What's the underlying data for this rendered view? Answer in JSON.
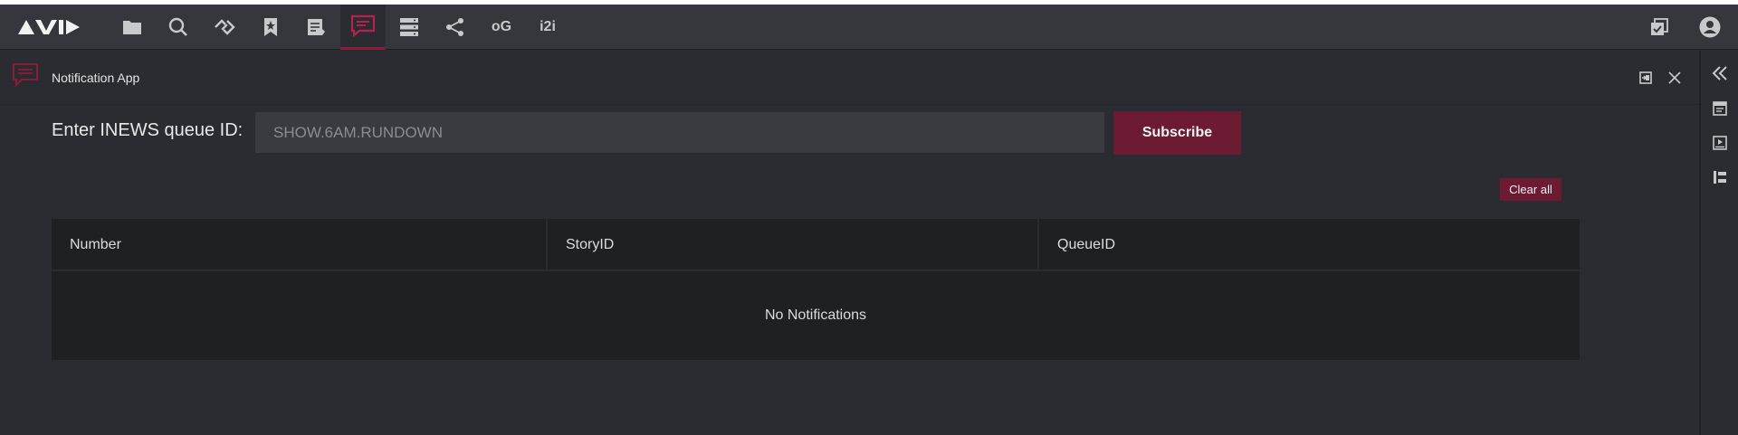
{
  "topbar": {
    "tools": [
      {
        "name": "folder-icon"
      },
      {
        "name": "search-icon"
      },
      {
        "name": "link-icon"
      },
      {
        "name": "bookmark-star-icon"
      },
      {
        "name": "document-edit-icon"
      },
      {
        "name": "chat-icon",
        "active": true
      },
      {
        "name": "server-icon"
      },
      {
        "name": "share-icon"
      },
      {
        "name": "og-text-icon",
        "label": "oG"
      },
      {
        "name": "i2i-text-icon",
        "label": "i2i"
      }
    ],
    "right": [
      "tasks-icon",
      "user-avatar-icon"
    ]
  },
  "app": {
    "title": "Notification App"
  },
  "form": {
    "label": "Enter INEWS queue ID:",
    "placeholder": "SHOW.6AM.RUNDOWN",
    "subscribe_label": "Subscribe",
    "clear_label": "Clear all"
  },
  "table": {
    "columns": [
      "Number",
      "StoryID",
      "QueueID"
    ],
    "empty_message": "No Notifications"
  },
  "colors": {
    "accent": "#6d1b33",
    "active_icon": "#b3234d",
    "background": "#2b2c31",
    "topbar": "#36373d"
  }
}
